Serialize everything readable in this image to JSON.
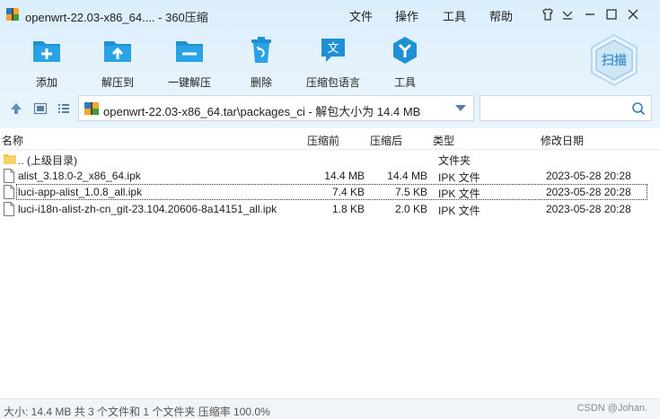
{
  "window": {
    "title": "openwrt-22.03-x86_64.... - 360压缩"
  },
  "menu": {
    "file": "文件",
    "operation": "操作",
    "tools": "工具",
    "help": "帮助"
  },
  "toolbar": {
    "add": "添加",
    "extract_to": "解压到",
    "one_click_extract": "一键解压",
    "delete": "删除",
    "archive_language": "压缩包语言",
    "tools": "工具",
    "scan": "扫描"
  },
  "path": {
    "text": "openwrt-22.03-x86_64.tar\\packages_ci - 解包大小为 14.4 MB"
  },
  "search": {
    "placeholder": ""
  },
  "columns": {
    "name": "名称",
    "compressed": "压缩前",
    "after": "压缩后",
    "type": "类型",
    "modified": "修改日期"
  },
  "files": [
    {
      "name": ".. (上级目录)",
      "size_before": "",
      "size_after": "",
      "type": "文件夹",
      "modified": ""
    },
    {
      "name": "alist_3.18.0-2_x86_64.ipk",
      "size_before": "14.4 MB",
      "size_after": "14.4 MB",
      "type": "IPK 文件",
      "modified": "2023-05-28 20:28"
    },
    {
      "name": "luci-app-alist_1.0.8_all.ipk",
      "size_before": "7.4 KB",
      "size_after": "7.5 KB",
      "type": "IPK 文件",
      "modified": "2023-05-28 20:28"
    },
    {
      "name": "luci-i18n-alist-zh-cn_git-23.104.20606-8a14151_all.ipk",
      "size_before": "1.8 KB",
      "size_after": "2.0 KB",
      "type": "IPK 文件",
      "modified": "2023-05-28 20:28"
    }
  ],
  "status": {
    "text": "大小: 14.4 MB 共 3 个文件和 1 个文件夹 压缩率 100.0%",
    "watermark": "CSDN @Johan."
  },
  "colors": {
    "accent": "#1e90d6",
    "header_bg": "#e2f1fc",
    "folder": "#f5c542"
  }
}
